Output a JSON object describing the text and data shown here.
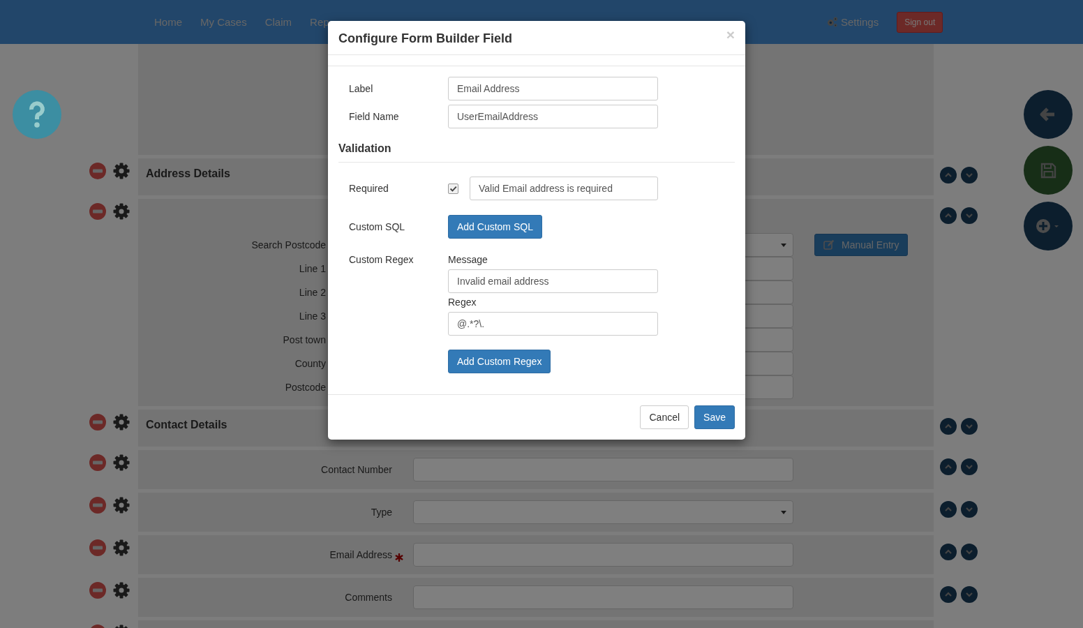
{
  "navbar": {
    "links": [
      {
        "label": "Home"
      },
      {
        "label": "My Cases"
      },
      {
        "label": "Claim"
      },
      {
        "label": "Rep"
      }
    ],
    "settings": "Settings",
    "sign_out": "Sign out"
  },
  "form_rows": [
    {
      "kind": "blank"
    },
    {
      "kind": "heading",
      "label": "Address Details"
    },
    {
      "kind": "address",
      "manual_entry": "Manual Entry",
      "fields": [
        {
          "label": "Search Postcode",
          "kind": "select"
        },
        {
          "label": "Line 1",
          "kind": "text"
        },
        {
          "label": "Line 2",
          "kind": "text"
        },
        {
          "label": "Line 3",
          "kind": "text"
        },
        {
          "label": "Post town",
          "kind": "text"
        },
        {
          "label": "County",
          "kind": "text"
        },
        {
          "label": "Postcode",
          "kind": "text"
        }
      ]
    },
    {
      "kind": "heading",
      "label": "Contact Details"
    },
    {
      "kind": "field",
      "label": "Contact Number",
      "input": {
        "kind": "text"
      },
      "required": false
    },
    {
      "kind": "field",
      "label": "Type",
      "input": {
        "kind": "select"
      },
      "required": false
    },
    {
      "kind": "field",
      "label": "Email Address",
      "input": {
        "kind": "text"
      },
      "required": true
    },
    {
      "kind": "field",
      "label": "Comments",
      "input": {
        "kind": "text"
      },
      "required": false
    },
    {
      "kind": "partial"
    }
  ],
  "modal": {
    "title": "Configure Form Builder Field",
    "close": "×",
    "fields": [
      {
        "label": "Label",
        "value": "Email Address"
      },
      {
        "label": "Field Name",
        "value": "UserEmailAddress"
      }
    ],
    "validation": {
      "heading": "Validation",
      "required": {
        "label": "Required",
        "checked": true,
        "message": "Valid Email address is required"
      },
      "custom_sql": {
        "label": "Custom SQL",
        "button": "Add Custom SQL"
      },
      "custom_regex": {
        "label": "Custom Regex",
        "message_label": "Message",
        "message": "Invalid email address",
        "regex_label": "Regex",
        "regex": "@.*?\\.",
        "button": "Add Custom Regex"
      }
    },
    "buttons": {
      "cancel": "Cancel",
      "save": "Save"
    }
  }
}
